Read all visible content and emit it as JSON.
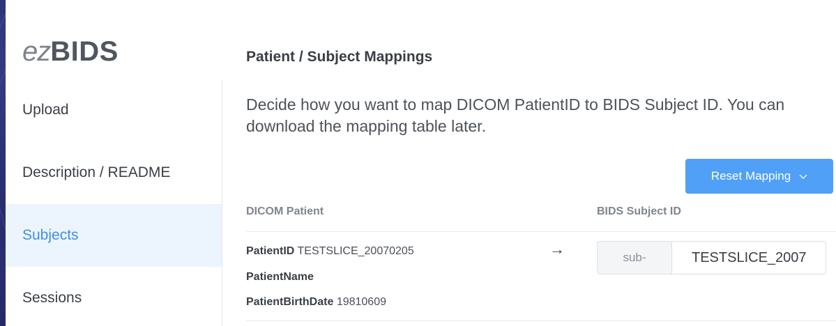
{
  "brand": {
    "prefix": "ez",
    "name": "BIDS"
  },
  "sidebar": {
    "items": [
      {
        "label": "Upload",
        "active": false
      },
      {
        "label": "Description / README",
        "active": false
      },
      {
        "label": "Subjects",
        "active": true
      },
      {
        "label": "Sessions",
        "active": false
      }
    ]
  },
  "main": {
    "title": "Patient / Subject Mappings",
    "description": "Decide how you want to map DICOM PatientID to BIDS Subject ID. You can download the mapping table later.",
    "reset_button": {
      "label": "Reset Mapping",
      "icon": "chevron-down-icon"
    },
    "table": {
      "headers": [
        "DICOM Patient",
        "BIDS Subject ID"
      ],
      "rows": [
        {
          "patient_id_label": "PatientID",
          "patient_id_value": "TESTSLICE_20070205",
          "patient_name_label": "PatientName",
          "patient_name_value": "",
          "birth_date_label": "PatientBirthDate",
          "birth_date_value": "19810609",
          "arrow_icon": "right-arrow-icon",
          "subject_prefix": "sub-",
          "subject_value": "TESTSLICE_2007"
        }
      ]
    }
  },
  "colors": {
    "accent": "#4fa0f6",
    "active_bg": "#ecf4fd",
    "active_text": "#3f8fe8",
    "background": "#1a1d4a"
  }
}
